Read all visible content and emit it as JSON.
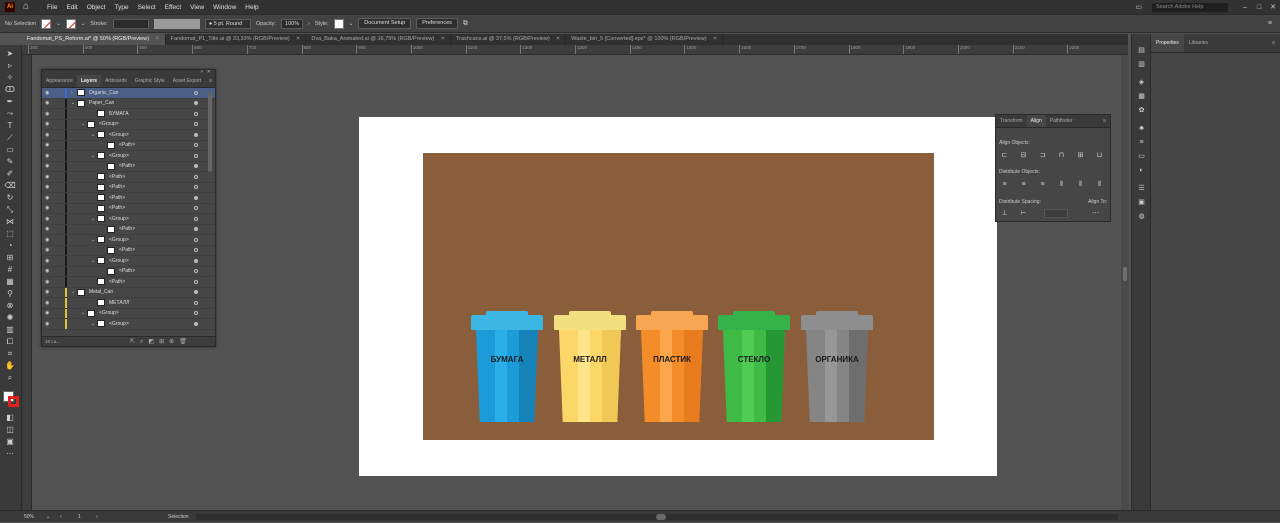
{
  "app": {
    "logo_text": "Ai",
    "menu": [
      "File",
      "Edit",
      "Object",
      "Type",
      "Select",
      "Effect",
      "View",
      "Window",
      "Help"
    ],
    "search_placeholder": "Search Adobe Help",
    "window_controls": [
      "minimize-icon",
      "maximize-icon",
      "close-icon"
    ]
  },
  "control_bar": {
    "selection_label": "No Selection",
    "stroke_label": "Stroke:",
    "brush_value": "5 pt. Round",
    "opacity_label": "Opacity:",
    "opacity_value": "100%",
    "style_label": "Style:",
    "doc_setup": "Document Setup",
    "preferences": "Preferences"
  },
  "tabs": [
    {
      "label": "Fandomat_PS_Reform.ai* @ 50% (RGB/Preview)",
      "active": true
    },
    {
      "label": "Fandomat_P1_Title.ai @ 33,33% (RGB/Preview)",
      "active": false
    },
    {
      "label": "Dva_Baka_Animated.ai @ 16,75% (RGB/Preview)",
      "active": false
    },
    {
      "label": "Trashcans.ai @ 37,5% (RGB/Preview)",
      "active": false
    },
    {
      "label": "Waste_bin_5 [Converted].eps* @ 100% (RGB/Preview)",
      "active": false
    }
  ],
  "ruler": [
    "300",
    "400",
    "500",
    "600",
    "700",
    "800",
    "900",
    "1000",
    "1100",
    "1200",
    "1300",
    "1400",
    "1500",
    "1600",
    "1700",
    "1800",
    "1900",
    "2000",
    "2100",
    "2200"
  ],
  "layers_panel": {
    "tabs": [
      "Appearance",
      "Layers",
      "Artboards",
      "Graphic Style",
      "Asset Export"
    ],
    "active_tab": "Layers",
    "rows": [
      {
        "name": "Organic_Can",
        "indent": 0,
        "expand": "›",
        "selected": true,
        "bar": "#3d6bd6"
      },
      {
        "name": "Paper_Can",
        "indent": 0,
        "expand": "⌄",
        "selected": false,
        "bar": "#1a1a1a"
      },
      {
        "name": "БУМАГА",
        "indent": 2,
        "expand": "",
        "selected": false,
        "bar": "#1a1a1a"
      },
      {
        "name": "<Group>",
        "indent": 1,
        "expand": "⌄",
        "selected": false,
        "bar": "#1a1a1a"
      },
      {
        "name": "<Group>",
        "indent": 2,
        "expand": "⌄",
        "selected": false,
        "bar": "#1a1a1a"
      },
      {
        "name": "<Path>",
        "indent": 3,
        "expand": "",
        "selected": false,
        "bar": "#1a1a1a"
      },
      {
        "name": "<Group>",
        "indent": 2,
        "expand": "⌄",
        "selected": false,
        "bar": "#1a1a1a"
      },
      {
        "name": "<Path>",
        "indent": 3,
        "expand": "",
        "selected": false,
        "bar": "#1a1a1a"
      },
      {
        "name": "<Path>",
        "indent": 2,
        "expand": "",
        "selected": false,
        "bar": "#1a1a1a"
      },
      {
        "name": "<Path>",
        "indent": 2,
        "expand": "",
        "selected": false,
        "bar": "#1a1a1a"
      },
      {
        "name": "<Path>",
        "indent": 2,
        "expand": "",
        "selected": false,
        "bar": "#1a1a1a"
      },
      {
        "name": "<Path>",
        "indent": 2,
        "expand": "",
        "selected": false,
        "bar": "#1a1a1a"
      },
      {
        "name": "<Group>",
        "indent": 2,
        "expand": "⌄",
        "selected": false,
        "bar": "#1a1a1a"
      },
      {
        "name": "<Path>",
        "indent": 3,
        "expand": "",
        "selected": false,
        "bar": "#1a1a1a"
      },
      {
        "name": "<Group>",
        "indent": 2,
        "expand": "⌄",
        "selected": false,
        "bar": "#1a1a1a"
      },
      {
        "name": "<Path>",
        "indent": 3,
        "expand": "",
        "selected": false,
        "bar": "#1a1a1a"
      },
      {
        "name": "<Group>",
        "indent": 2,
        "expand": "⌄",
        "selected": false,
        "bar": "#1a1a1a"
      },
      {
        "name": "<Path>",
        "indent": 3,
        "expand": "",
        "selected": false,
        "bar": "#1a1a1a"
      },
      {
        "name": "<Path>",
        "indent": 2,
        "expand": "",
        "selected": false,
        "bar": "#1a1a1a"
      },
      {
        "name": "Metal_Can",
        "indent": 0,
        "expand": "⌄",
        "selected": false,
        "bar": "#e0c23a"
      },
      {
        "name": "МЕТАЛЛ",
        "indent": 2,
        "expand": "",
        "selected": false,
        "bar": "#e0c23a"
      },
      {
        "name": "<Group>",
        "indent": 1,
        "expand": "⌄",
        "selected": false,
        "bar": "#e0c23a"
      },
      {
        "name": "<Group>",
        "indent": 2,
        "expand": "⌄",
        "selected": false,
        "bar": "#e0c23a"
      }
    ],
    "footer": "16 La..."
  },
  "align_panel": {
    "tabs": [
      "Transform",
      "Align",
      "Pathfinder"
    ],
    "active_tab": "Align",
    "align_objects": "Align Objects:",
    "distribute_objects": "Distribute Objects:",
    "distribute_spacing": "Distribute Spacing:",
    "align_to": "Align To:"
  },
  "properties_panel": {
    "tabs": [
      "Properties",
      "Libraries"
    ],
    "active_tab": "Properties"
  },
  "artwork": {
    "background": "#8a5d3b",
    "bins": [
      {
        "label": "БУМАГА",
        "lid": "#3cb6e3",
        "body": "#1b9bd8",
        "mid": "#2ab0e8",
        "shade": "#147fb4"
      },
      {
        "label": "МЕТАЛЛ",
        "lid": "#f2e080",
        "body": "#fcd767",
        "mid": "#ffe48a",
        "shade": "#eec452"
      },
      {
        "label": "ПЛАСТИК",
        "lid": "#f7a751",
        "body": "#f48c2a",
        "mid": "#fba64b",
        "shade": "#e6781d"
      },
      {
        "label": "СТЕКЛО",
        "lid": "#33b34a",
        "body": "#3fbb45",
        "mid": "#4fcc52",
        "shade": "#229033"
      },
      {
        "label": "ОРГАНИКА",
        "lid": "#8e8e8e",
        "body": "#858585",
        "mid": "#979797",
        "shade": "#6a6a6a"
      }
    ]
  },
  "status": {
    "zoom": "50%",
    "page": "1",
    "tool": "Selection"
  }
}
